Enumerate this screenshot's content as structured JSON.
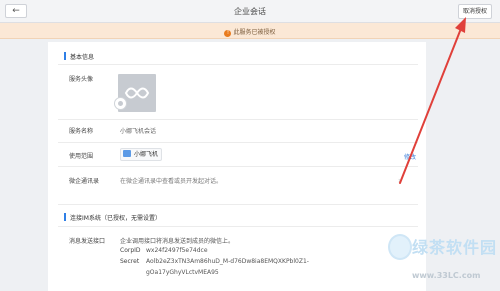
{
  "header": {
    "back_glyph": "←",
    "title": "企业会话",
    "revoke_label": "取消授权"
  },
  "banner": {
    "icon_glyph": "!",
    "text": "此服务已被授权"
  },
  "basic": {
    "section_title": "基本信息",
    "avatar_label": "服务头像",
    "name_label": "服务名称",
    "name_value": "小娜飞机会话",
    "scope_label": "使用范围",
    "scope_value": "小娜飞机",
    "edit_label": "修改",
    "contacts_label": "微企通讯录",
    "contacts_value": "在微企通讯录中查看或员开发起对话。",
    "chevron_glyph": "›"
  },
  "im": {
    "section_title": "连接IM系统（已授权，无需设置）",
    "endpoint_label": "消息发送接口",
    "endpoint_desc": "企业调用接口将消息发送到成员的微信上。",
    "corpid_label": "CorpID",
    "corpid_value": "wx24f2497f5e74dce",
    "secret_label": "Secret",
    "secret_line1": "Aolb2eZ3xTN3Am86huD_M-d76Dw8ia8EMQXKPbl0Z1-",
    "secret_line2": "gOa17yGhyVLctvMEA95"
  },
  "watermark": {
    "brand": "绿茶软件园",
    "url": "www.33LC.com"
  },
  "colors": {
    "accent": "#2f7fe6",
    "banner_bg": "#fbe8d6",
    "warning": "#e97b1d",
    "arrow": "#e0403a"
  }
}
